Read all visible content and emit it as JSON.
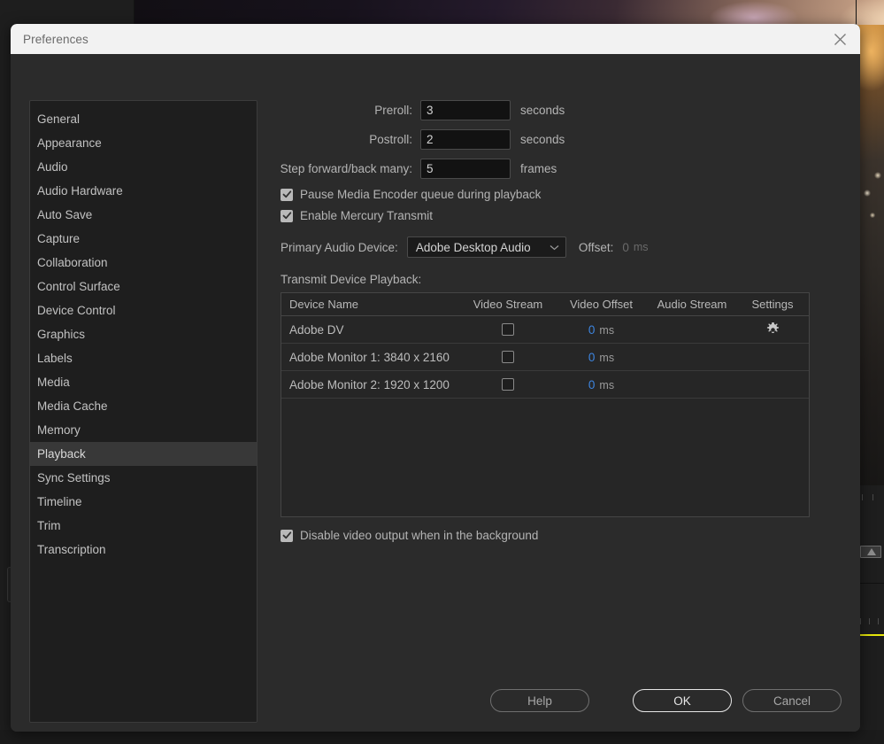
{
  "background": {
    "app_name": "video-editor-backdrop"
  },
  "dialog": {
    "title": "Preferences",
    "close_icon": "close-icon"
  },
  "sidebar": {
    "items": [
      {
        "label": "General",
        "selected": false
      },
      {
        "label": "Appearance",
        "selected": false
      },
      {
        "label": "Audio",
        "selected": false
      },
      {
        "label": "Audio Hardware",
        "selected": false
      },
      {
        "label": "Auto Save",
        "selected": false
      },
      {
        "label": "Capture",
        "selected": false
      },
      {
        "label": "Collaboration",
        "selected": false
      },
      {
        "label": "Control Surface",
        "selected": false
      },
      {
        "label": "Device Control",
        "selected": false
      },
      {
        "label": "Graphics",
        "selected": false
      },
      {
        "label": "Labels",
        "selected": false
      },
      {
        "label": "Media",
        "selected": false
      },
      {
        "label": "Media Cache",
        "selected": false
      },
      {
        "label": "Memory",
        "selected": false
      },
      {
        "label": "Playback",
        "selected": true
      },
      {
        "label": "Sync Settings",
        "selected": false
      },
      {
        "label": "Timeline",
        "selected": false
      },
      {
        "label": "Trim",
        "selected": false
      },
      {
        "label": "Transcription",
        "selected": false
      }
    ]
  },
  "playback": {
    "preroll": {
      "label": "Preroll:",
      "value": "3",
      "unit": "seconds"
    },
    "postroll": {
      "label": "Postroll:",
      "value": "2",
      "unit": "seconds"
    },
    "step": {
      "label": "Step forward/back many:",
      "value": "5",
      "unit": "frames"
    },
    "pause_encoder": {
      "label": "Pause Media Encoder queue during playback",
      "checked": true
    },
    "enable_mercury": {
      "label": "Enable Mercury Transmit",
      "checked": true
    },
    "primary_audio": {
      "label": "Primary Audio Device:",
      "value": "Adobe Desktop Audio",
      "options": [
        "Adobe Desktop Audio"
      ],
      "offset_label": "Offset:",
      "offset_value": "0",
      "offset_unit": "ms"
    },
    "transmit_section_label": "Transmit Device Playback:",
    "table": {
      "columns": [
        "Device Name",
        "Video Stream",
        "Video Offset",
        "Audio Stream",
        "Settings"
      ],
      "rows": [
        {
          "device_name": "Adobe DV",
          "video_stream_checked": false,
          "video_offset": "0",
          "video_offset_unit": "ms",
          "audio_stream": "",
          "settings_icon": "gear-icon",
          "has_settings": true
        },
        {
          "device_name": "Adobe Monitor 1: 3840 x 2160",
          "video_stream_checked": false,
          "video_offset": "0",
          "video_offset_unit": "ms",
          "audio_stream": "",
          "settings_icon": "",
          "has_settings": false
        },
        {
          "device_name": "Adobe Monitor 2: 1920 x 1200",
          "video_stream_checked": false,
          "video_offset": "0",
          "video_offset_unit": "ms",
          "audio_stream": "",
          "settings_icon": "",
          "has_settings": false
        }
      ]
    },
    "disable_video_bg": {
      "label": "Disable video output when in the background",
      "checked": true
    }
  },
  "footer": {
    "help_label": "Help",
    "ok_label": "OK",
    "cancel_label": "Cancel"
  },
  "colors": {
    "dialog_bg": "#2b2b2b",
    "titlebar_bg": "#f2f2f2",
    "sidebar_bg": "#1e1e1e",
    "selected_row": "#383838",
    "link_blue": "#3d85e0",
    "timeline_yellow": "#e8e80c"
  }
}
